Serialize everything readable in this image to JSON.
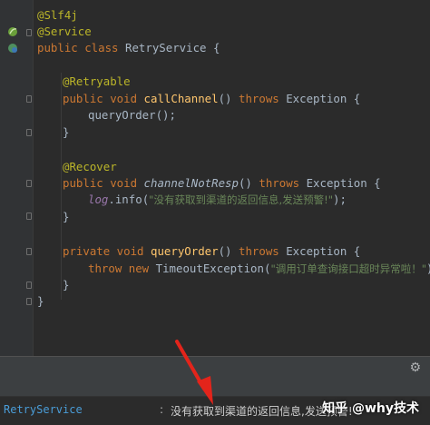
{
  "code": {
    "l1": {
      "ann": "@Slf4j"
    },
    "l2": {
      "ann": "@Service"
    },
    "l3": {
      "kw": "public class ",
      "name": "RetryService",
      "rest": " {"
    },
    "l5": {
      "ann": "@Retryable"
    },
    "l6": {
      "kw": "public void ",
      "fn": "callChannel",
      "mid": "() ",
      "kw2": "throws ",
      "rest": "Exception {"
    },
    "l7": {
      "text": "queryOrder();"
    },
    "l8": {
      "text": "}"
    },
    "l10": {
      "ann": "@Recover"
    },
    "l11": {
      "kw": "public void ",
      "fn": "channelNotResp",
      "mid": "() ",
      "kw2": "throws ",
      "rest": "Exception {"
    },
    "l12": {
      "field": "log",
      "mid": ".info(",
      "str": "\"没有获取到渠道的返回信息,发送预警!\"",
      "rest": ");"
    },
    "l13": {
      "text": "}"
    },
    "l15": {
      "kw": "private void ",
      "fn": "queryOrder",
      "mid": "() ",
      "kw2": "throws ",
      "rest": "Exception {"
    },
    "l16": {
      "kw": "throw new ",
      "mid": "TimeoutException(",
      "str": "\"调用订单查询接口超时异常啦！\"",
      "rest": ");"
    },
    "l17": {
      "text": "}"
    },
    "l18": {
      "text": "}"
    }
  },
  "console": {
    "logger": "RetryService",
    "separator": ":",
    "message": "没有获取到渠道的返回信息,发送预警!"
  },
  "watermark": "知乎 @why技术",
  "icons": {
    "gutter_bean": "spring-bean-icon",
    "settings": "gear-icon",
    "annotation_arrow": "red-arrow-icon"
  },
  "colors": {
    "background": "#2b2b2b",
    "keyword": "#cc7832",
    "annotation": "#bbb529",
    "function": "#ffc66d",
    "string": "#6a8759",
    "arrow": "#e3241b"
  }
}
